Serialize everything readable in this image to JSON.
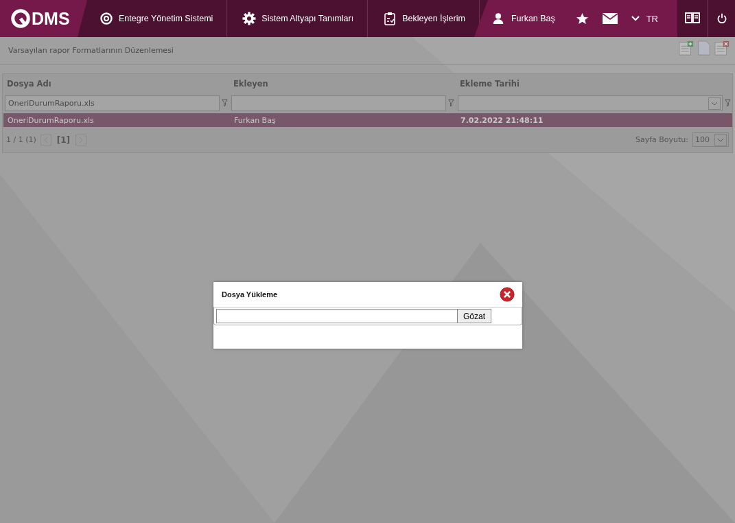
{
  "header": {
    "logo": "DMS",
    "nav": [
      {
        "kind": "modules",
        "label": "Entegre Yönetim Sistemi"
      },
      {
        "kind": "settings",
        "label": "Sistem Altyapı Tanımları"
      },
      {
        "kind": "tasks",
        "label": "Bekleyen İşlerim"
      }
    ],
    "user": "Furkan Baş",
    "language": "TR"
  },
  "panel": {
    "title": "Varsayılan rapor Formatlarının Düzenlemesi"
  },
  "grid": {
    "columns": [
      {
        "label": "Dosya Adı",
        "filter": "OneriDurumRaporu.xls",
        "dropdown": false
      },
      {
        "label": "Ekleyen",
        "dropdown": false
      },
      {
        "label": "Ekleme Tarihi",
        "dropdown": true
      }
    ],
    "rows": [
      {
        "cells": [
          "OneriDurumRaporu.xls",
          "Furkan Baş",
          "7.02.2022 21:48:11"
        ],
        "selected": true
      }
    ],
    "pager": {
      "summary": "1 / 1 (1)",
      "current": "[1]"
    },
    "page_size": {
      "label": "Sayfa Boyutu:",
      "value": "100"
    }
  },
  "dialog": {
    "title": "Dosya Yükleme",
    "browse_button": "Gözat"
  }
}
